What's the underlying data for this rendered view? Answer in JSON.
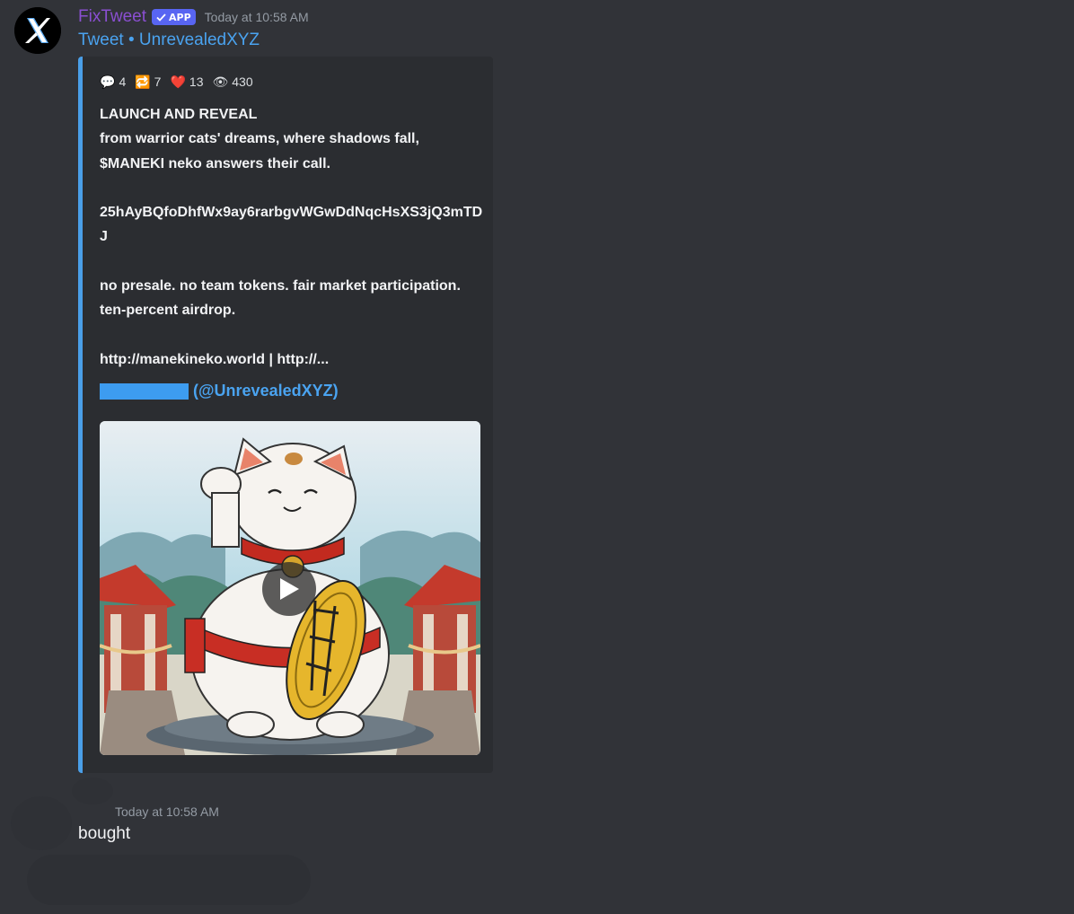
{
  "message": {
    "username": "FixTweet",
    "badge": "APP",
    "timestamp": "Today at 10:58 AM",
    "link": "Tweet • UnrevealedXYZ"
  },
  "embed": {
    "stats": [
      {
        "icon": "speech-bubble-icon",
        "glyph": "💬",
        "value": "4"
      },
      {
        "icon": "retweet-icon",
        "glyph": "🔁",
        "value": "7"
      },
      {
        "icon": "heart-icon",
        "glyph": "❤️",
        "value": "13"
      },
      {
        "icon": "eye-icon",
        "glyph": "👁",
        "value": "430"
      }
    ],
    "body": "LAUNCH AND REVEAL\nfrom warrior cats' dreams, where shadows fall,\n$MANEKI neko answers their call.\n\n25hAyBQfoDhfWx9ay6rarbgvWGwDdNqcHsXS3jQ3mTDJ\n\nno presale. no team tokens. fair market participation.\nten-percent airdrop.\n\nhttp://manekineko.world | http://...",
    "author_handle": "(@UnrevealedXYZ)",
    "media": {
      "type": "video",
      "subject": "maneki-neko-cat-illustration"
    }
  },
  "reply": {
    "timestamp": "Today at 10:58 AM",
    "text": "bought"
  },
  "colors": {
    "background": "#313338",
    "embed_bg": "#2b2d31",
    "embed_accent": "#4a9fe8",
    "username": "#8a4fd1",
    "link": "#4aa3f0",
    "badge": "#5865f2"
  }
}
